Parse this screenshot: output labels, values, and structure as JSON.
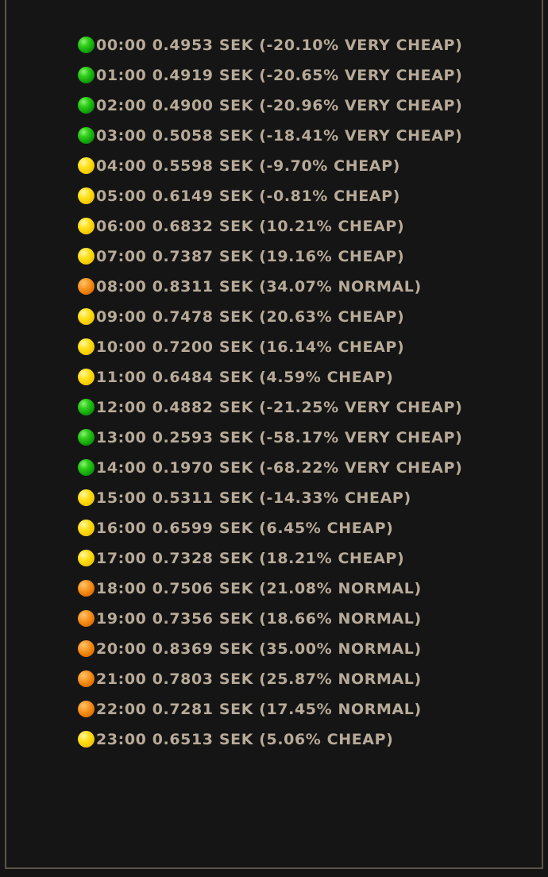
{
  "price_rows": [
    {
      "time": "00:00",
      "price": "0.4953",
      "currency": "SEK",
      "change": "-20.10%",
      "level": "VERY CHEAP",
      "indicator": "green",
      "icon": "green-circle-icon"
    },
    {
      "time": "01:00",
      "price": "0.4919",
      "currency": "SEK",
      "change": "-20.65%",
      "level": "VERY CHEAP",
      "indicator": "green",
      "icon": "green-circle-icon"
    },
    {
      "time": "02:00",
      "price": "0.4900",
      "currency": "SEK",
      "change": "-20.96%",
      "level": "VERY CHEAP",
      "indicator": "green",
      "icon": "green-circle-icon"
    },
    {
      "time": "03:00",
      "price": "0.5058",
      "currency": "SEK",
      "change": "-18.41%",
      "level": "VERY CHEAP",
      "indicator": "green",
      "icon": "green-circle-icon"
    },
    {
      "time": "04:00",
      "price": "0.5598",
      "currency": "SEK",
      "change": "-9.70%",
      "level": "CHEAP",
      "indicator": "yellow",
      "icon": "yellow-circle-icon"
    },
    {
      "time": "05:00",
      "price": "0.6149",
      "currency": "SEK",
      "change": "-0.81%",
      "level": "CHEAP",
      "indicator": "yellow",
      "icon": "yellow-circle-icon"
    },
    {
      "time": "06:00",
      "price": "0.6832",
      "currency": "SEK",
      "change": "10.21%",
      "level": "CHEAP",
      "indicator": "yellow",
      "icon": "yellow-circle-icon"
    },
    {
      "time": "07:00",
      "price": "0.7387",
      "currency": "SEK",
      "change": "19.16%",
      "level": "CHEAP",
      "indicator": "yellow",
      "icon": "yellow-circle-icon"
    },
    {
      "time": "08:00",
      "price": "0.8311",
      "currency": "SEK",
      "change": "34.07%",
      "level": "NORMAL",
      "indicator": "orange",
      "icon": "orange-circle-icon"
    },
    {
      "time": "09:00",
      "price": "0.7478",
      "currency": "SEK",
      "change": "20.63%",
      "level": "CHEAP",
      "indicator": "yellow",
      "icon": "yellow-circle-icon"
    },
    {
      "time": "10:00",
      "price": "0.7200",
      "currency": "SEK",
      "change": "16.14%",
      "level": "CHEAP",
      "indicator": "yellow",
      "icon": "yellow-circle-icon"
    },
    {
      "time": "11:00",
      "price": "0.6484",
      "currency": "SEK",
      "change": "4.59%",
      "level": "CHEAP",
      "indicator": "yellow",
      "icon": "yellow-circle-icon"
    },
    {
      "time": "12:00",
      "price": "0.4882",
      "currency": "SEK",
      "change": "-21.25%",
      "level": "VERY CHEAP",
      "indicator": "green",
      "icon": "green-circle-icon"
    },
    {
      "time": "13:00",
      "price": "0.2593",
      "currency": "SEK",
      "change": "-58.17%",
      "level": "VERY CHEAP",
      "indicator": "green",
      "icon": "green-circle-icon"
    },
    {
      "time": "14:00",
      "price": "0.1970",
      "currency": "SEK",
      "change": "-68.22%",
      "level": "VERY CHEAP",
      "indicator": "green",
      "icon": "green-circle-icon"
    },
    {
      "time": "15:00",
      "price": "0.5311",
      "currency": "SEK",
      "change": "-14.33%",
      "level": "CHEAP",
      "indicator": "yellow",
      "icon": "yellow-circle-icon"
    },
    {
      "time": "16:00",
      "price": "0.6599",
      "currency": "SEK",
      "change": "6.45%",
      "level": "CHEAP",
      "indicator": "yellow",
      "icon": "yellow-circle-icon"
    },
    {
      "time": "17:00",
      "price": "0.7328",
      "currency": "SEK",
      "change": "18.21%",
      "level": "CHEAP",
      "indicator": "yellow",
      "icon": "yellow-circle-icon"
    },
    {
      "time": "18:00",
      "price": "0.7506",
      "currency": "SEK",
      "change": "21.08%",
      "level": "NORMAL",
      "indicator": "orange",
      "icon": "orange-circle-icon"
    },
    {
      "time": "19:00",
      "price": "0.7356",
      "currency": "SEK",
      "change": "18.66%",
      "level": "NORMAL",
      "indicator": "orange",
      "icon": "orange-circle-icon"
    },
    {
      "time": "20:00",
      "price": "0.8369",
      "currency": "SEK",
      "change": "35.00%",
      "level": "NORMAL",
      "indicator": "orange",
      "icon": "orange-circle-icon"
    },
    {
      "time": "21:00",
      "price": "0.7803",
      "currency": "SEK",
      "change": "25.87%",
      "level": "NORMAL",
      "indicator": "orange",
      "icon": "orange-circle-icon"
    },
    {
      "time": "22:00",
      "price": "0.7281",
      "currency": "SEK",
      "change": "17.45%",
      "level": "NORMAL",
      "indicator": "orange",
      "icon": "orange-circle-icon"
    },
    {
      "time": "23:00",
      "price": "0.6513",
      "currency": "SEK",
      "change": "5.06%",
      "level": "CHEAP",
      "indicator": "yellow",
      "icon": "yellow-circle-icon"
    }
  ],
  "colors": {
    "background": "#151515",
    "border": "#5c5449",
    "text": "#b7aa98",
    "green": "#1fb814",
    "yellow": "#f7d000",
    "orange": "#ee8410"
  }
}
